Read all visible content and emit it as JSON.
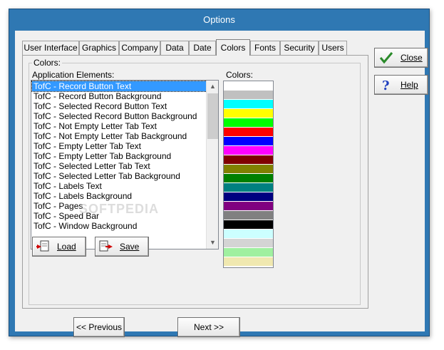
{
  "window": {
    "title": "Options"
  },
  "tabs": [
    {
      "label": "User Interface"
    },
    {
      "label": "Graphics"
    },
    {
      "label": "Company"
    },
    {
      "label": "Data"
    },
    {
      "label": "Date"
    },
    {
      "label": "Colors",
      "active": true
    },
    {
      "label": "Fonts"
    },
    {
      "label": "Security"
    },
    {
      "label": "Users"
    }
  ],
  "colors_group": {
    "label": "Colors:",
    "elements_label": "Application Elements:",
    "colors_label": "Colors:",
    "elements": [
      "TofC - Record Button Text",
      "TofC - Record Button Background",
      "TofC - Selected Record Button Text",
      "TofC - Selected Record Button Background",
      "TofC - Not Empty Letter Tab Text",
      "TofC - Not Empty Letter Tab Background",
      "TofC - Empty Letter Tab Text",
      "TofC - Empty Letter Tab Background",
      "TofC - Selected Letter Tab Text",
      "TofC - Selected Letter Tab Background",
      "TofC - Labels Text",
      "TofC - Labels Background",
      "TofC - Pages",
      "TofC - Speed Bar",
      "TofC - Window Background"
    ],
    "selected_index": 0,
    "swatches": [
      "#ffffff",
      "#c0c0c0",
      "#00ffff",
      "#ffff00",
      "#00ff00",
      "#ff0000",
      "#0000ff",
      "#ff00ff",
      "#800000",
      "#808000",
      "#008000",
      "#008080",
      "#000080",
      "#800080",
      "#808080",
      "#000000",
      "#ccffff",
      "#d4d4d4",
      "#a0f0a0",
      "#f0e8b0"
    ]
  },
  "buttons": {
    "load": "Load",
    "save": "Save",
    "close": "Close",
    "help": "Help",
    "previous": "<< Previous",
    "next": "Next >>"
  },
  "watermark": "SOFTPEDIA"
}
